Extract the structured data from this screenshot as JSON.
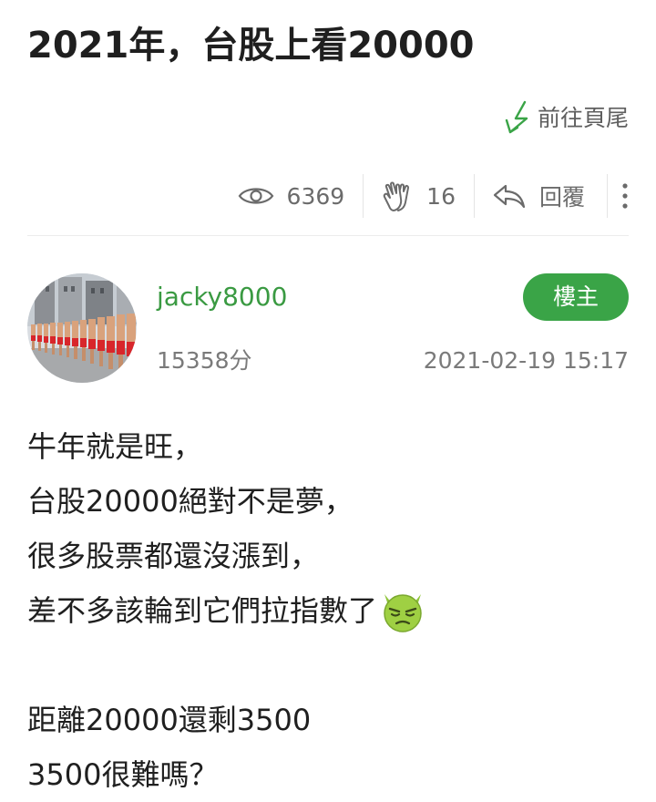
{
  "post": {
    "title": "2021年，台股上看20000",
    "goto_end_label": "前往頁尾"
  },
  "stats": {
    "views": "6369",
    "claps": "16",
    "reply_label": "回覆"
  },
  "author": {
    "username": "jacky8000",
    "points": "15358分",
    "badge": "樓主",
    "timestamp": "2021-02-19 15:17"
  },
  "content": {
    "lines": [
      "牛年就是旺，",
      "台股20000絕對不是夢，",
      "很多股票都還沒漲到，",
      "差不多該輪到它們拉指數了",
      "",
      "距離20000還剩3500",
      "3500很難嗎？"
    ]
  },
  "icons": {
    "goto_end": "down-left-arrow-icon",
    "views": "eye-icon",
    "claps": "clap-hands-icon",
    "reply": "reply-arrow-icon",
    "more": "vertical-dots-icon",
    "emoji": "green-devil-face-emoji"
  },
  "colors": {
    "accent_green": "#3aa447",
    "username_green": "#3a9a42",
    "muted_gray": "#7a7a7a"
  }
}
